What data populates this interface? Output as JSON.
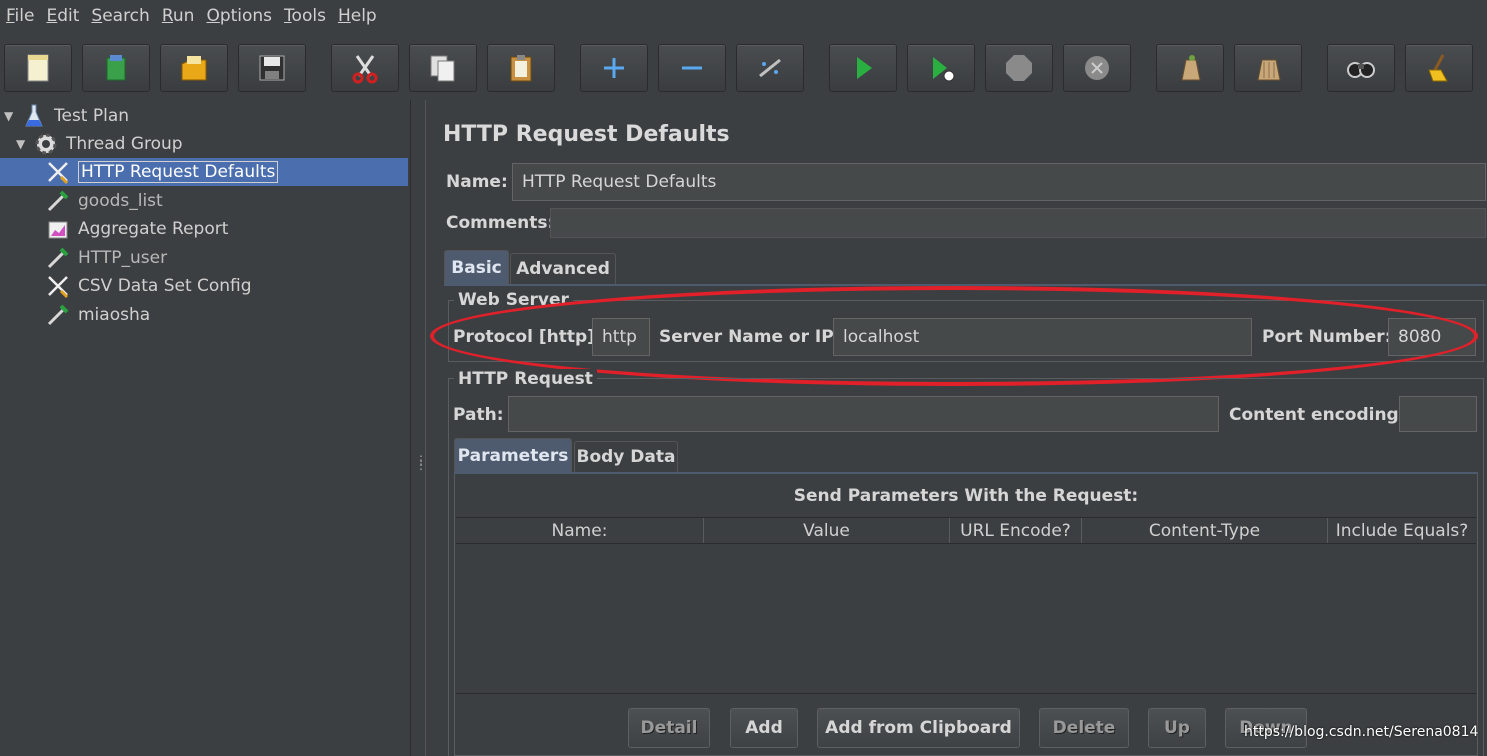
{
  "menu": [
    {
      "u": "F",
      "rest": "ile"
    },
    {
      "u": "E",
      "rest": "dit"
    },
    {
      "u": "S",
      "rest": "earch"
    },
    {
      "u": "R",
      "rest": "un"
    },
    {
      "u": "O",
      "rest": "ptions"
    },
    {
      "u": "T",
      "rest": "ools"
    },
    {
      "u": "H",
      "rest": "elp"
    }
  ],
  "toolbar_icons": [
    "new-icon",
    "templates-icon",
    "open-icon",
    "save-icon",
    "cut-icon",
    "copy-icon",
    "paste-icon",
    "expand-icon",
    "collapse-icon",
    "toggle-icon",
    "start-icon",
    "start-no-pauses-icon",
    "stop-icon",
    "shutdown-icon",
    "clear-icon",
    "clear-all-icon",
    "search-icon",
    "reset-search-icon"
  ],
  "tree": {
    "test_plan": "Test Plan",
    "thread_group": "Thread Group",
    "items": [
      {
        "label": "HTTP Request Defaults",
        "icon": "config-element-icon",
        "selected": true
      },
      {
        "label": "goods_list",
        "icon": "sampler-icon",
        "disabled": true
      },
      {
        "label": "Aggregate Report",
        "icon": "listener-icon"
      },
      {
        "label": "HTTP_user",
        "icon": "sampler-icon",
        "disabled": true
      },
      {
        "label": "CSV Data Set Config",
        "icon": "config-element-icon"
      },
      {
        "label": "miaosha",
        "icon": "sampler-icon"
      }
    ]
  },
  "panel": {
    "title": "HTTP Request Defaults",
    "name_label": "Name:",
    "name_value": "HTTP Request Defaults",
    "comments_label": "Comments:",
    "comments_value": "",
    "tabs": [
      "Basic",
      "Advanced"
    ],
    "web_server": {
      "title": "Web Server",
      "protocol_label": "Protocol [http]:",
      "protocol_value": "http",
      "server_label": "Server Name or IP:",
      "server_value": "localhost",
      "port_label": "Port Number:",
      "port_value": "8080"
    },
    "http_request": {
      "title": "HTTP Request",
      "path_label": "Path:",
      "path_value": "",
      "encoding_label": "Content encoding:",
      "encoding_value": ""
    },
    "sub_tabs": [
      "Parameters",
      "Body Data"
    ],
    "params_title": "Send Parameters With the Request:",
    "columns": [
      "Name:",
      "Value",
      "URL Encode?",
      "Content-Type",
      "Include Equals?"
    ],
    "buttons": [
      "Detail",
      "Add",
      "Add from Clipboard",
      "Delete",
      "Up",
      "Down"
    ]
  },
  "watermark": "https://blog.csdn.net/Serena0814",
  "colors": {
    "selection": "#4b6eaf",
    "annotation": "#e1202a",
    "background": "#3c3f41"
  }
}
